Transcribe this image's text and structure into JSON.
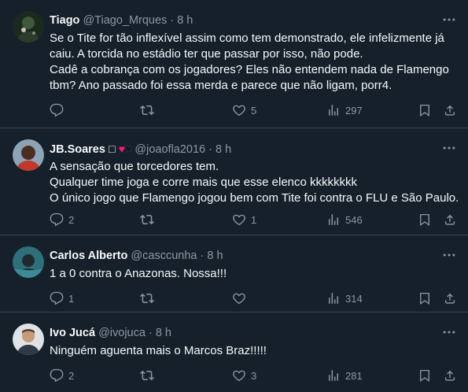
{
  "tweets": [
    {
      "name": "Tiago",
      "handle": "@Tiago_Mrques",
      "dot": "·",
      "time": "8 h",
      "lines": [
        "Se o Tite for tão inflexível assim como tem demonstrado, ele infelizmente já",
        "caiu. A torcida no estádio ter que passar por isso, não pode.",
        "Cadê a cobrança com os jogadores? Eles não entendem nada de Flamengo",
        "tbm? Ano passado foi essa merda e parece que não ligam, porr4."
      ],
      "replies": "",
      "retweets": "",
      "likes": "5",
      "views": "297"
    },
    {
      "name": "JB.Soares",
      "name_suffix": "□",
      "hearts": [
        "♥",
        "♥"
      ],
      "handle": "@joaofla2016",
      "dot": "·",
      "time": "8 h",
      "lines": [
        "A sensação que torcedores tem.",
        "Qualquer time joga e corre mais que esse elenco kkkkkkkk",
        "O único jogo que Flamengo jogou bem com Tite foi contra o FLU e São Paulo."
      ],
      "replies": "2",
      "retweets": "",
      "likes": "1",
      "views": "546"
    },
    {
      "name": "Carlos Alberto",
      "handle": "@casccunha",
      "dot": "·",
      "time": "8 h",
      "lines": [
        "1 a 0 contra o Anazonas. Nossa!!!"
      ],
      "replies": "1",
      "retweets": "",
      "likes": "",
      "views": "314"
    },
    {
      "name": "Ivo Jucá",
      "handle": "@ivojuca",
      "dot": "·",
      "time": "8 h",
      "lines": [
        "Ninguém aguenta mais o Marcos Braz!!!!!"
      ],
      "replies": "2",
      "retweets": "",
      "likes": "3",
      "views": "281"
    }
  ],
  "colors": {
    "background": "#15202b",
    "text": "#f7f9f9",
    "secondary": "#8b98a5",
    "divider": "#38444d",
    "heart_red": "#f91880"
  },
  "icons": [
    "reply-icon",
    "retweet-icon",
    "like-icon",
    "views-icon",
    "bookmark-icon",
    "share-icon",
    "more-icon"
  ]
}
